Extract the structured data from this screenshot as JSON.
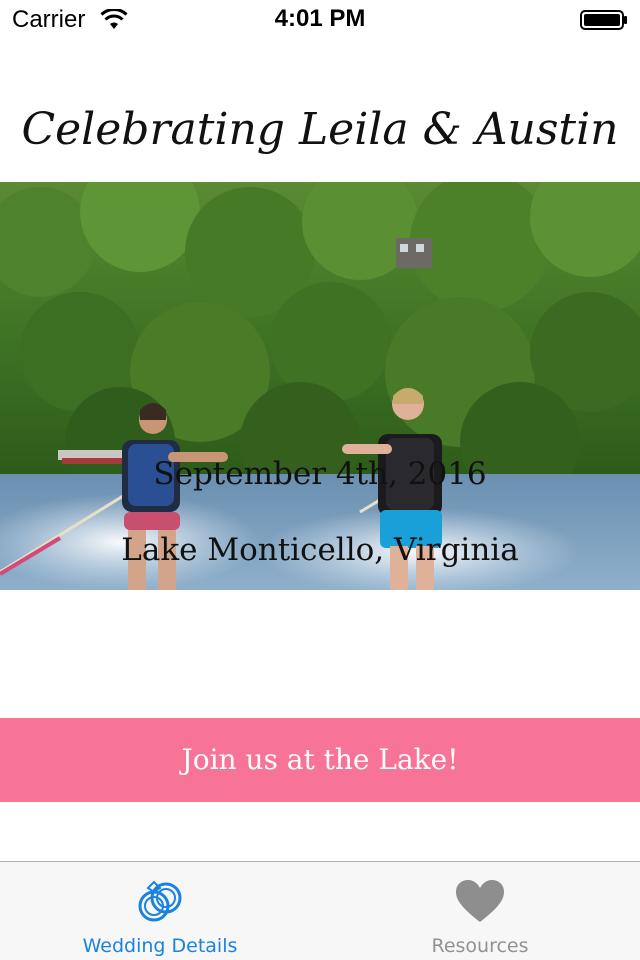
{
  "status_bar": {
    "carrier": "Carrier",
    "time": "4:01 PM"
  },
  "title": "Celebrating Leila & Austin",
  "hero": {
    "date": "September 4th, 2016",
    "location": "Lake Monticello, Virginia"
  },
  "join_button": {
    "label": "Join us at the Lake!",
    "color": "#f87497"
  },
  "tabs": [
    {
      "label": "Wedding Details",
      "icon": "rings-icon",
      "active": true,
      "color": "#1b82e0"
    },
    {
      "label": "Resources",
      "icon": "heart-icon",
      "active": false,
      "color": "#929292"
    }
  ]
}
